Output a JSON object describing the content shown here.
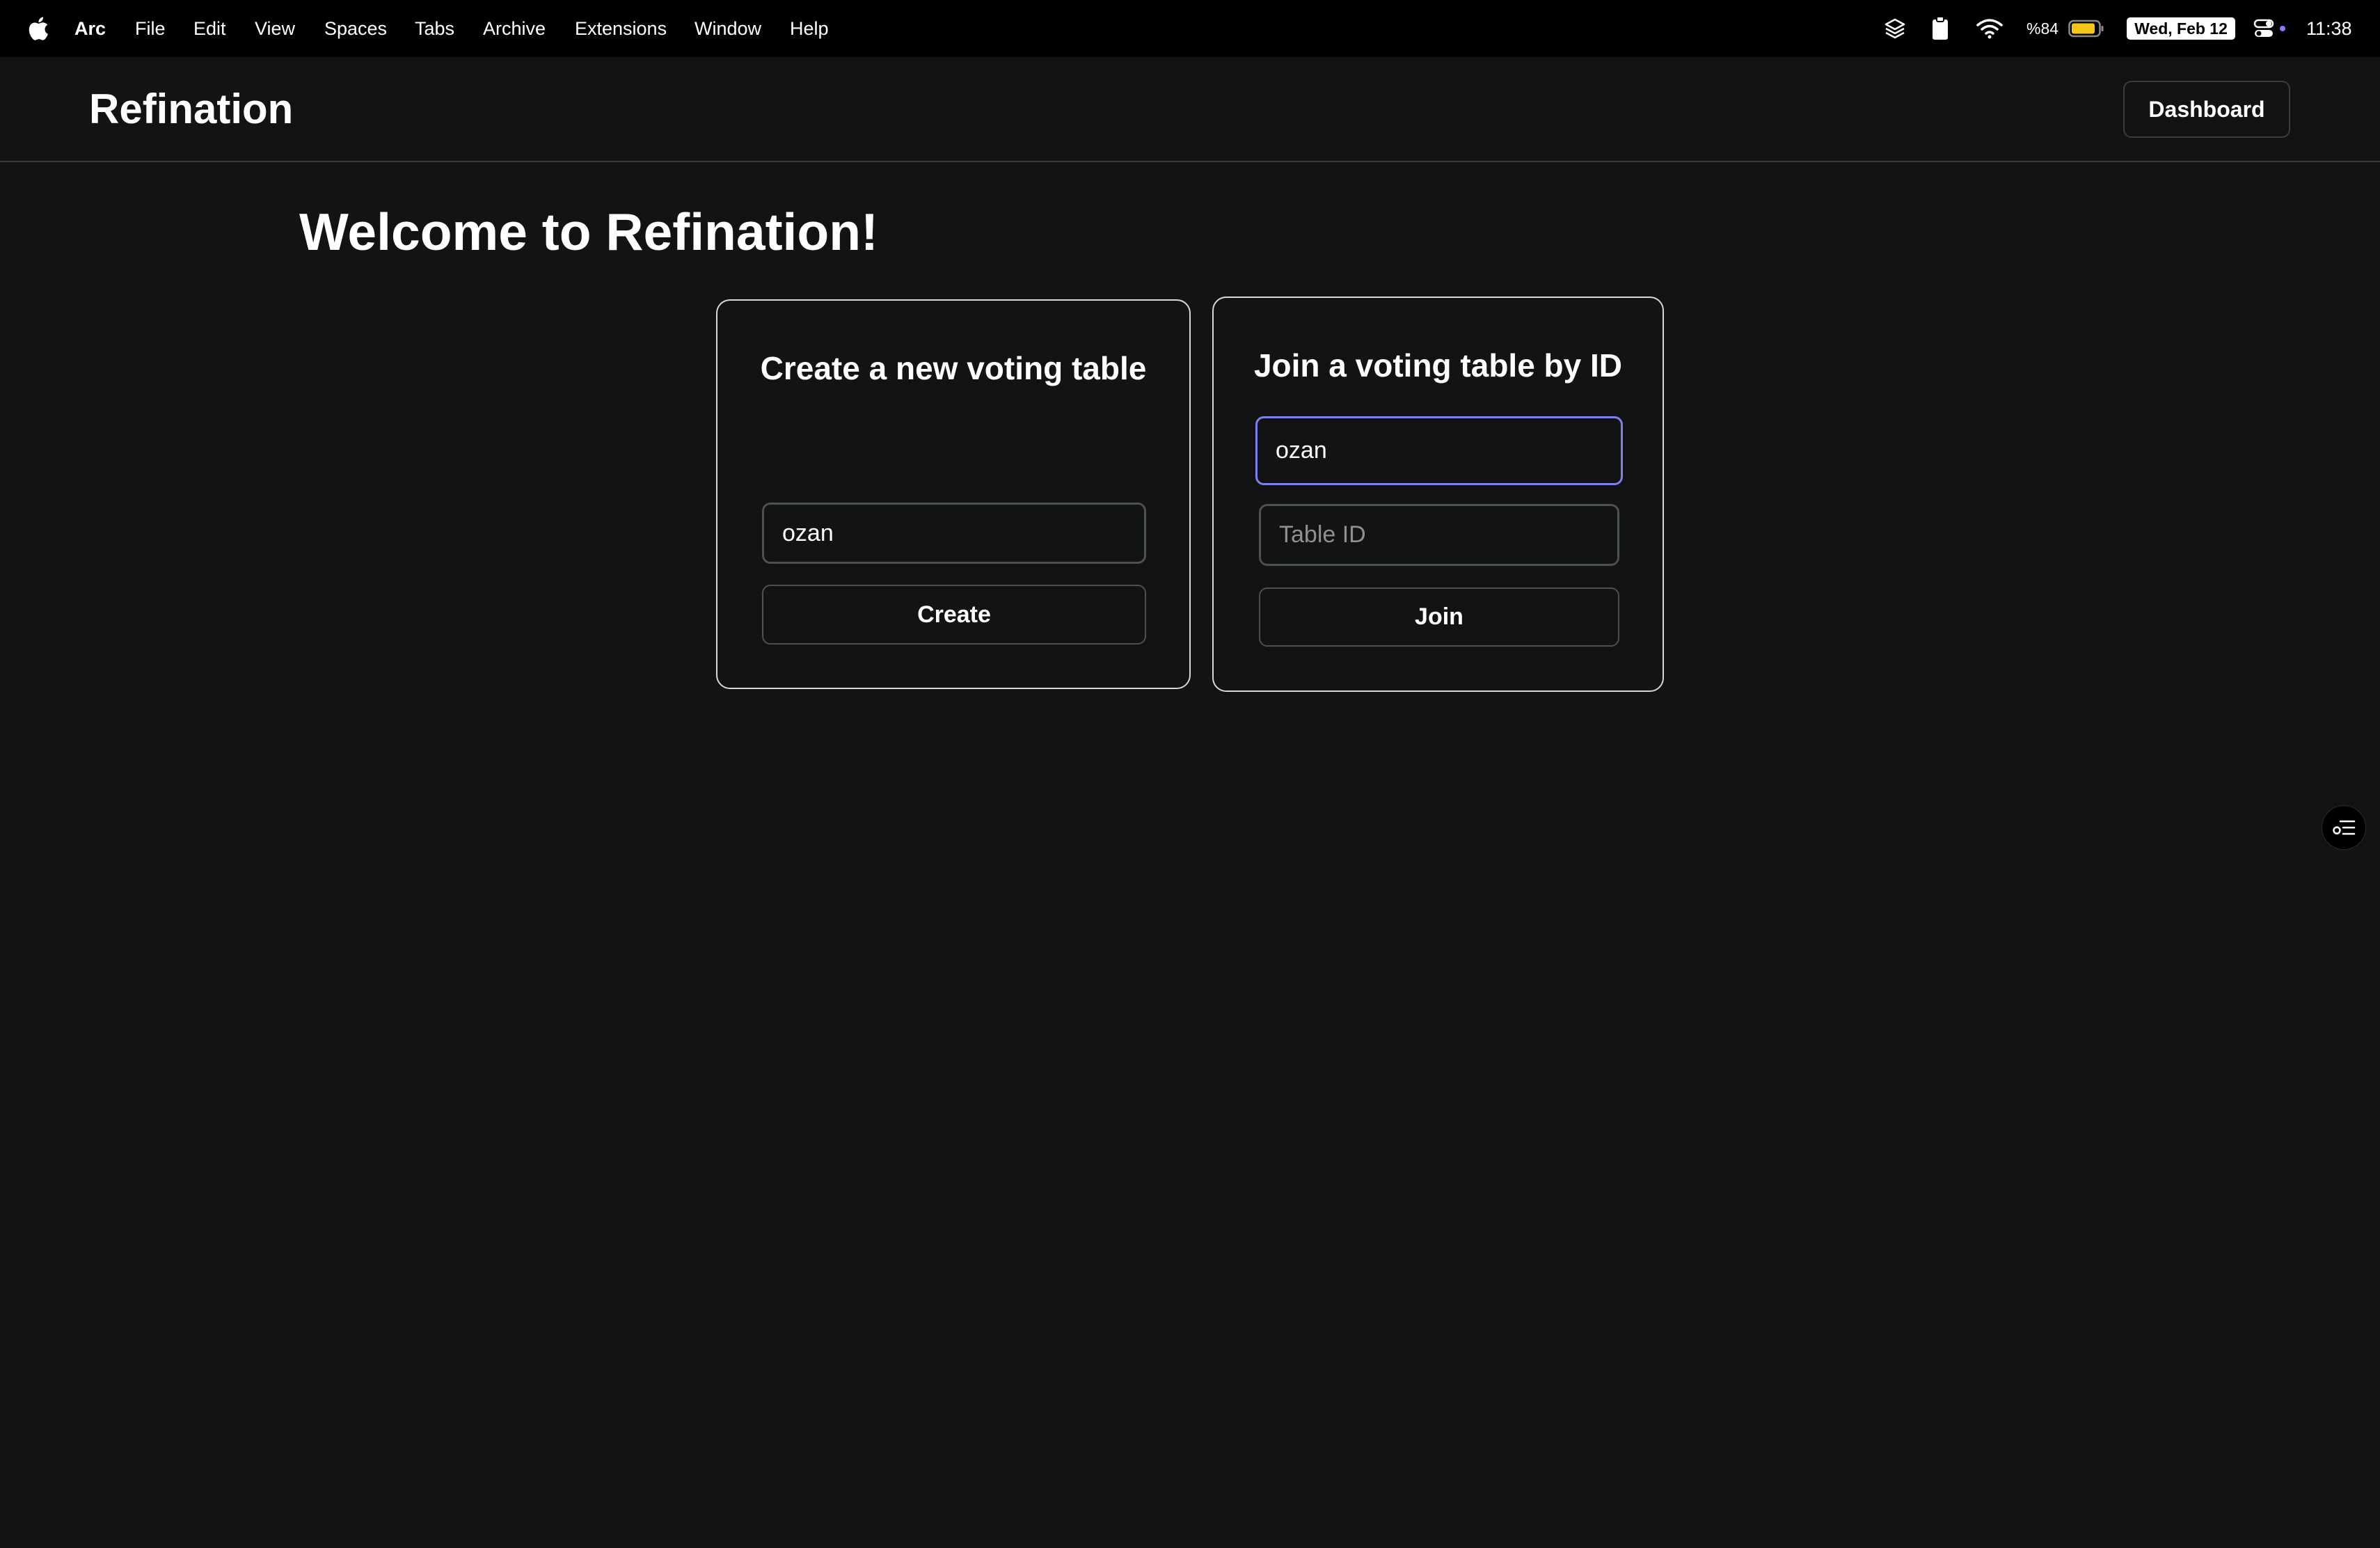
{
  "menubar": {
    "app": "Arc",
    "items": [
      "File",
      "Edit",
      "View",
      "Spaces",
      "Tabs",
      "Archive",
      "Extensions",
      "Window",
      "Help"
    ],
    "battery": "%84",
    "date": "Wed, Feb 12",
    "time": "11:38",
    "icons": [
      "apple-icon",
      "layers-icon",
      "clipboard-icon",
      "wifi-icon",
      "battery-icon",
      "control-center-icon"
    ]
  },
  "header": {
    "brand": "Refination",
    "dashboard_label": "Dashboard"
  },
  "main": {
    "welcome": "Welcome to Refination!",
    "create_card": {
      "title": "Create a new voting table",
      "name_value": "ozan",
      "button_label": "Create"
    },
    "join_card": {
      "title": "Join a voting table by ID",
      "name_value": "ozan",
      "table_id_placeholder": "Table ID",
      "button_label": "Join"
    }
  },
  "colors": {
    "background": "#121413",
    "menubar": "#000000",
    "focus_border": "#7f7ff0",
    "battery_fill": "#f5c518"
  }
}
